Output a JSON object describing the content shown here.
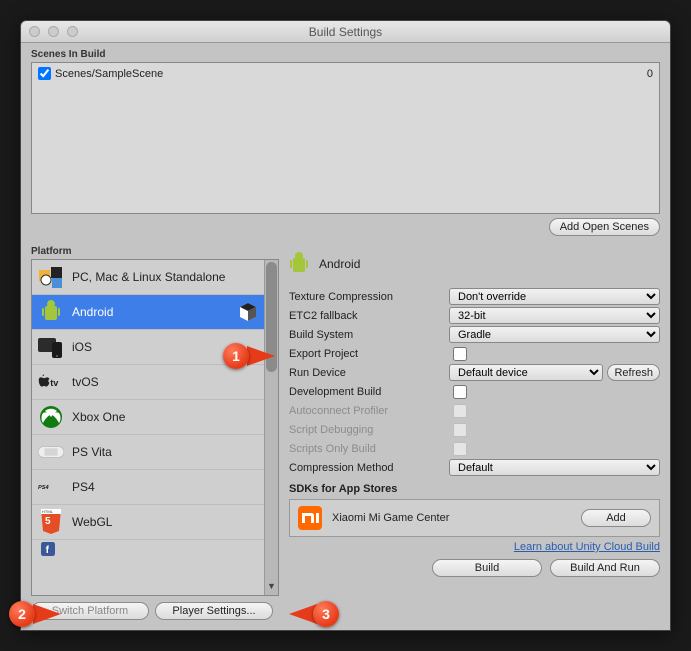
{
  "window": {
    "title": "Build Settings"
  },
  "scenes": {
    "heading": "Scenes In Build",
    "items": [
      {
        "name": "Scenes/SampleScene",
        "index": "0",
        "checked": true
      }
    ],
    "add_button": "Add Open Scenes"
  },
  "platform": {
    "heading": "Platform",
    "items": [
      {
        "key": "standalone",
        "label": "PC, Mac & Linux Standalone"
      },
      {
        "key": "android",
        "label": "Android"
      },
      {
        "key": "ios",
        "label": "iOS"
      },
      {
        "key": "tvos",
        "label": "tvOS"
      },
      {
        "key": "xboxone",
        "label": "Xbox One"
      },
      {
        "key": "psvita",
        "label": "PS Vita"
      },
      {
        "key": "ps4",
        "label": "PS4"
      },
      {
        "key": "webgl",
        "label": "WebGL"
      }
    ],
    "selected": "Android",
    "switch_button": "Switch Platform",
    "player_settings_button": "Player Settings..."
  },
  "settings": {
    "title": "Android",
    "texture_compression": {
      "label": "Texture Compression",
      "value": "Don't override"
    },
    "etc2_fallback": {
      "label": "ETC2 fallback",
      "value": "32-bit"
    },
    "build_system": {
      "label": "Build System",
      "value": "Gradle"
    },
    "export_project": {
      "label": "Export Project",
      "checked": false
    },
    "run_device": {
      "label": "Run Device",
      "value": "Default device",
      "refresh": "Refresh"
    },
    "development_build": {
      "label": "Development Build",
      "checked": false
    },
    "autoconnect_profiler": {
      "label": "Autoconnect Profiler",
      "checked": false
    },
    "script_debugging": {
      "label": "Script Debugging",
      "checked": false
    },
    "scripts_only_build": {
      "label": "Scripts Only Build",
      "checked": false
    },
    "compression_method": {
      "label": "Compression Method",
      "value": "Default"
    },
    "sdk_section": {
      "title": "SDKs for App Stores",
      "item": "Xiaomi Mi Game Center",
      "add": "Add"
    },
    "learn_link": "Learn about Unity Cloud Build",
    "build": "Build",
    "build_and_run": "Build And Run"
  },
  "callouts": {
    "one": "1",
    "two": "2",
    "three": "3"
  }
}
